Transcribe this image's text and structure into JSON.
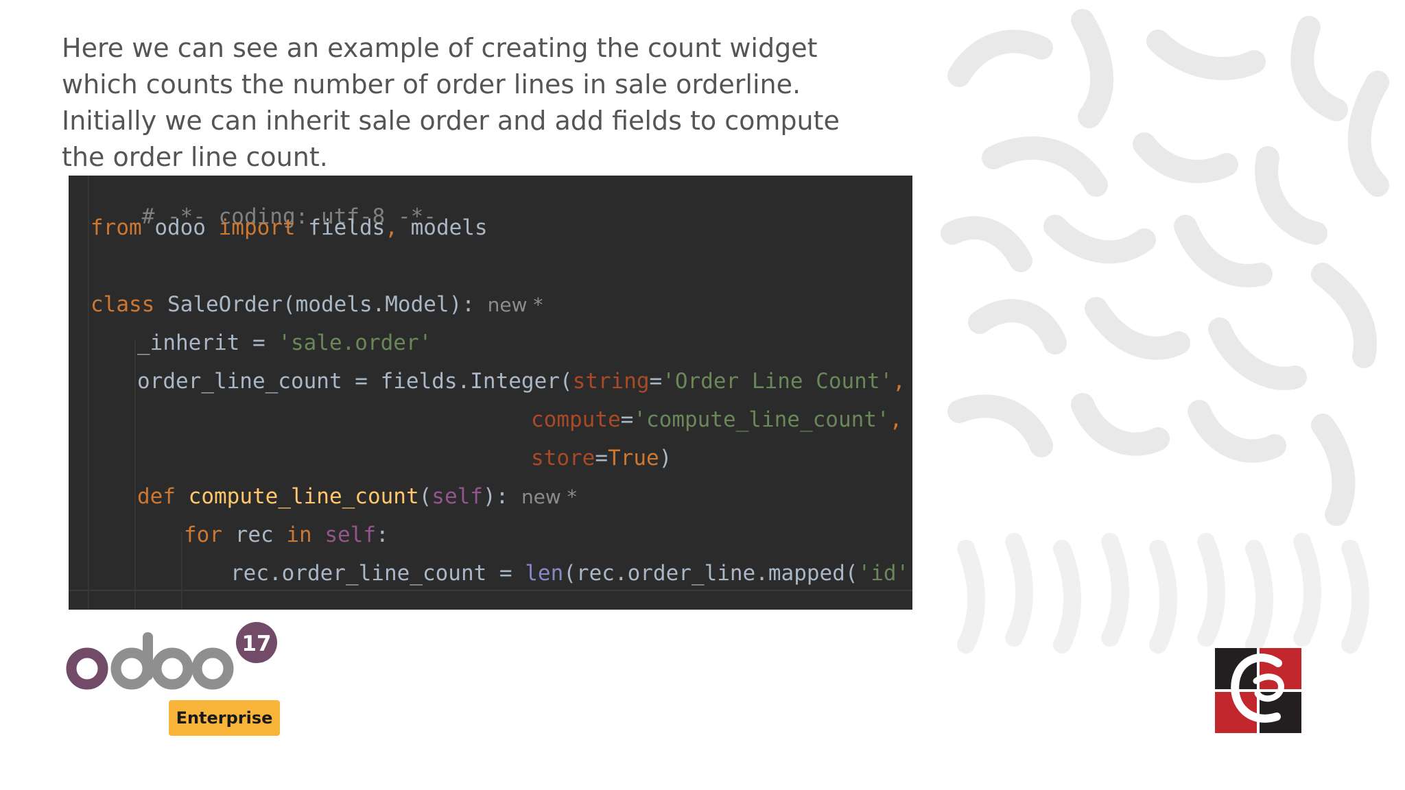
{
  "intro_text": "Here we can see an example of creating the count widget which counts the number of order lines in sale orderline. Initially we can inherit sale order and add fields to compute the order line count.",
  "code": {
    "coding_comment": "# -*- coding: utf-8 -*-",
    "kw_from": "from",
    "module_odoo": " odoo ",
    "kw_import": "import",
    "import_fields": " fields",
    "comma": ",",
    "import_models": " models",
    "kw_class": "class",
    "class_decl": " SaleOrder(models.Model):",
    "new_hint": "new *",
    "inherit_lhs": "_inherit = ",
    "inherit_value": "'sale.order'",
    "field_lhs": "order_line_count = fields.Integer(",
    "param_string": "string",
    "equals": "=",
    "string_value": "'Order Line Count'",
    "param_compute": "compute",
    "compute_value": "'compute_line_count'",
    "param_store": "store",
    "kw_true": "True",
    "close_paren": ")",
    "kw_def": "def",
    "func_name": " compute_line_count",
    "open_paren": "(",
    "kw_self": "self",
    "func_close": "):",
    "kw_for": "for",
    "loop_var": " rec ",
    "kw_in": "in",
    "space": " ",
    "colon": ":",
    "assign_lhs": "rec.order_line_count = ",
    "builtin_len": "len",
    "mapped_call": "(rec.order_line.mapped(",
    "id_value": "'id'",
    "close_parens": "))"
  },
  "odoo_logo": {
    "wordmark": "odoo",
    "version": "17",
    "edition": "Enterprise"
  },
  "colors": {
    "odoo_purple": "#714b67",
    "odoo_grey": "#8f8f8f",
    "badge_yellow": "#f9b53a",
    "code_bg": "#2b2b2b",
    "company_red": "#c1272d",
    "company_dark": "#231f20"
  }
}
